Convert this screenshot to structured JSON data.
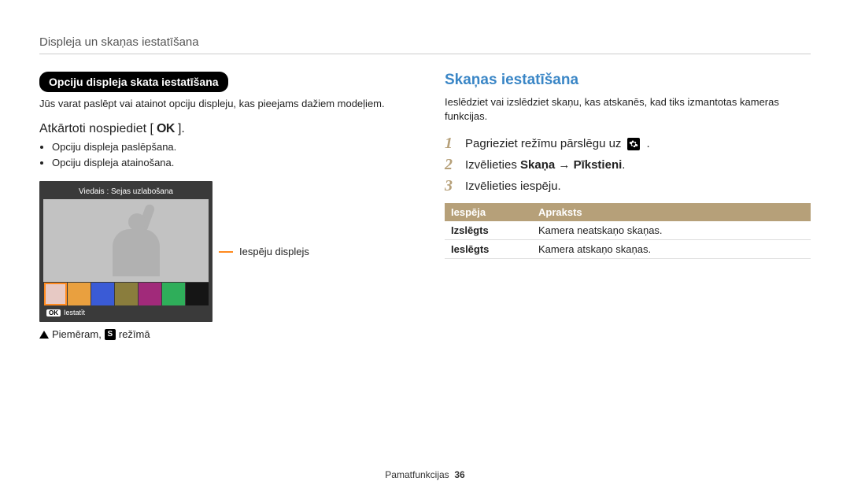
{
  "header": "Displeja un skaņas iestatīšana",
  "left": {
    "pill": "Opciju displeja skata iestatīšana",
    "intro": "Jūs varat paslēpt vai atainot opciju displeju, kas pieejams dažiem modeļiem.",
    "sub_pre": "Atkārtoti nospiediet [",
    "sub_ok": "OK",
    "sub_post": "].",
    "bullets": [
      "Opciju displeja paslēpšana.",
      "Opciju displeja atainošana."
    ],
    "camera": {
      "title": "Viedais : Sejas uzlabošana",
      "ok_chip": "OK",
      "foot": "Iestatīt",
      "thumb_colors": [
        "#e7c9c4",
        "#e9a03f",
        "#3a5bd6",
        "#8a7d3d",
        "#a12a7a",
        "#2fae5a",
        "#151515"
      ]
    },
    "callout": "Iespēju displejs",
    "example_pre": "Piemēram,",
    "example_s": "S",
    "example_post": "režīmā"
  },
  "right": {
    "title": "Skaņas iestatīšana",
    "intro": "Ieslēdziet vai izslēdziet skaņu, kas atskanēs, kad tiks izmantotas kameras funkcijas.",
    "steps": {
      "s1": {
        "n": "1",
        "text": "Pagrieziet režīmu pārslēgu uz"
      },
      "s2": {
        "n": "2",
        "pre": "Izvēlieties ",
        "b1": "Skaņa",
        "arrow": "→",
        "b2": "Pīkstieni",
        "post": "."
      },
      "s3": {
        "n": "3",
        "text": "Izvēlieties iespēju."
      }
    },
    "table": {
      "h_option": "Iespēja",
      "h_desc": "Apraksts",
      "rows": [
        {
          "k": "Izslēgts",
          "v": "Kamera neatskaņo skaņas."
        },
        {
          "k": "Ieslēgts",
          "v": "Kamera atskaņo skaņas."
        }
      ]
    }
  },
  "footer": {
    "label": "Pamatfunkcijas",
    "page": "36"
  },
  "icons": {
    "triangle_up": "triangle-up-icon",
    "gear": "gear-icon",
    "orange_dash": "orange-callout-dash",
    "s_chip": "s-mode-chip",
    "ok_button": "ok-button-glyph"
  }
}
